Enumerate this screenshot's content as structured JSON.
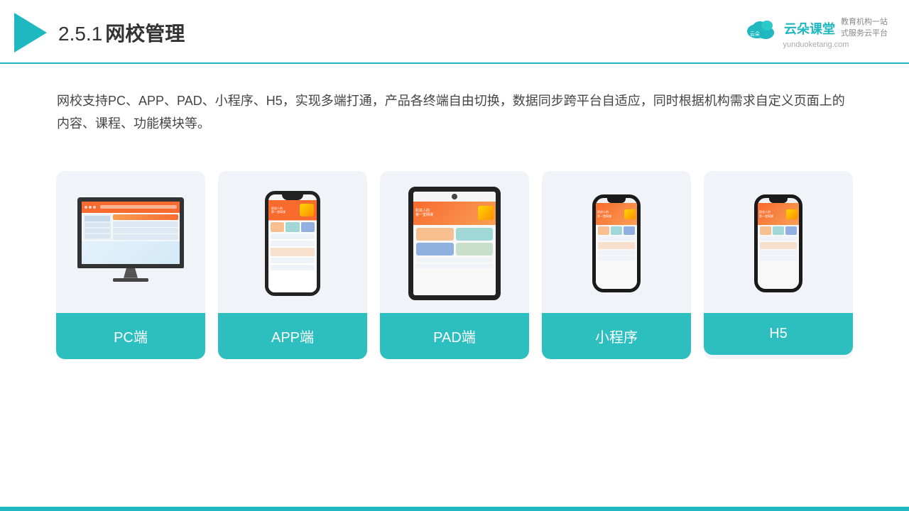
{
  "header": {
    "section_number": "2.5.1",
    "title": "网校管理",
    "brand": {
      "name": "云朵课堂",
      "url": "yunduoketang.com",
      "tagline": "教育机构一站",
      "tagline2": "式服务云平台"
    }
  },
  "description": {
    "text": "网校支持PC、APP、PAD、小程序、H5，实现多端打通，产品各终端自由切换，数据同步跨平台自适应，同时根据机构需求自定义页面上的内容、课程、功能模块等。"
  },
  "cards": [
    {
      "id": "pc",
      "label": "PC端"
    },
    {
      "id": "app",
      "label": "APP端"
    },
    {
      "id": "pad",
      "label": "PAD端"
    },
    {
      "id": "miniprogram",
      "label": "小程序"
    },
    {
      "id": "h5",
      "label": "H5"
    }
  ],
  "colors": {
    "teal": "#2dbfbf",
    "accent": "#f96a2e",
    "card_bg": "#eef2f7"
  }
}
